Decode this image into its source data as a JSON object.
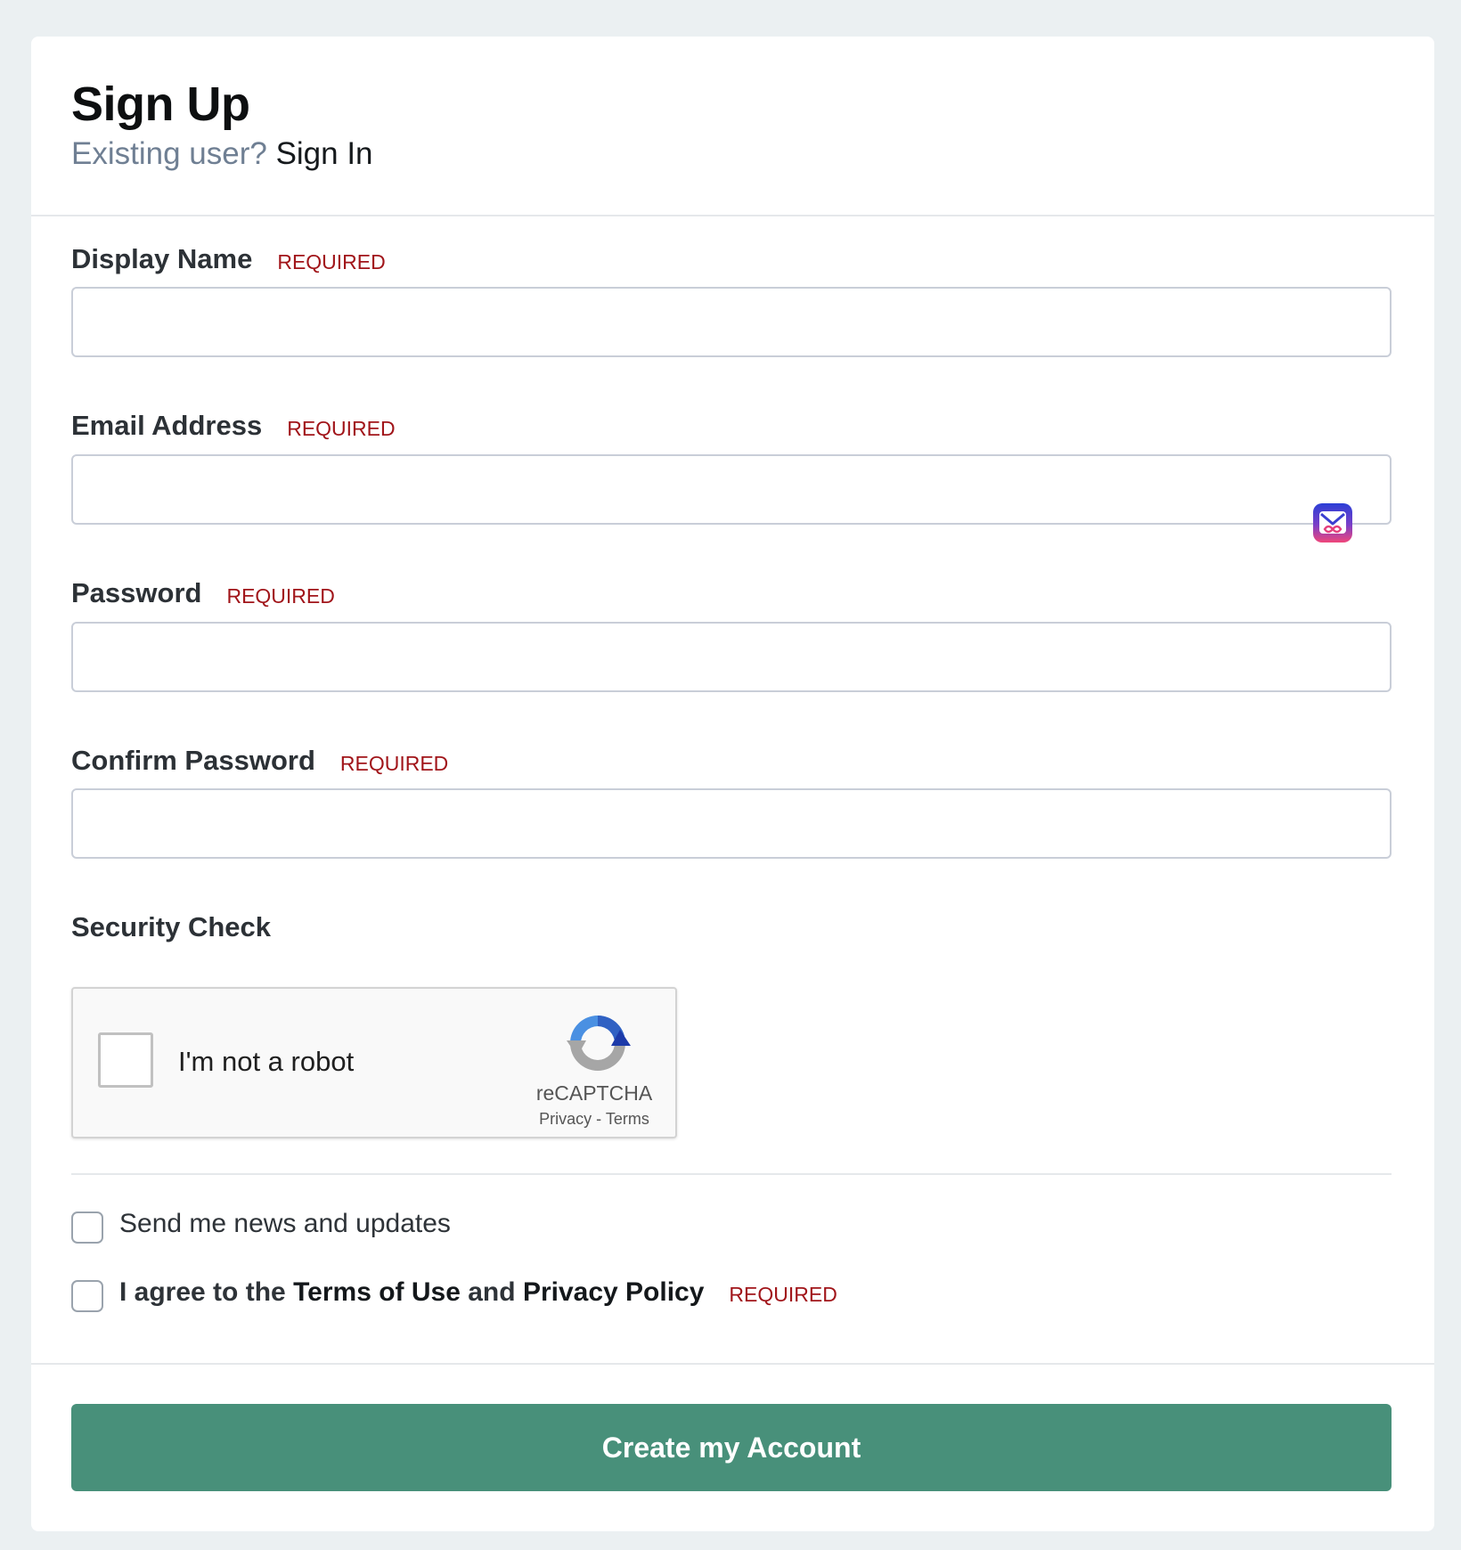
{
  "header": {
    "title": "Sign Up",
    "existing_user_text": "Existing user?",
    "sign_in_link": "Sign In"
  },
  "form": {
    "fields": [
      {
        "label": "Display Name",
        "required": "REQUIRED",
        "value": "",
        "placeholder": ""
      },
      {
        "label": "Email Address",
        "required": "REQUIRED",
        "value": "",
        "placeholder": ""
      },
      {
        "label": "Password",
        "required": "REQUIRED",
        "value": "",
        "placeholder": ""
      },
      {
        "label": "Confirm Password",
        "required": "REQUIRED",
        "value": "",
        "placeholder": ""
      }
    ],
    "security_check_label": "Security Check",
    "recaptcha": {
      "checkbox_label": "I'm not a robot",
      "brand": "reCAPTCHA",
      "privacy_link": "Privacy",
      "separator": "-",
      "terms_link": "Terms"
    },
    "news_checkbox_label": "Send me news and updates",
    "agree": {
      "prefix": "I agree to the",
      "terms_link": "Terms of Use",
      "and_text": "and",
      "privacy_link": "Privacy Policy",
      "required": "REQUIRED"
    },
    "submit_label": "Create my Account"
  },
  "icons": {
    "email_field_extension": "email-extension-icon",
    "recaptcha": "recaptcha-logo-icon"
  },
  "colors": {
    "background": "#ebf0f2",
    "card": "#ffffff",
    "required": "#a1151a",
    "muted_text": "#6f7f93",
    "submit_button": "#48907a"
  }
}
